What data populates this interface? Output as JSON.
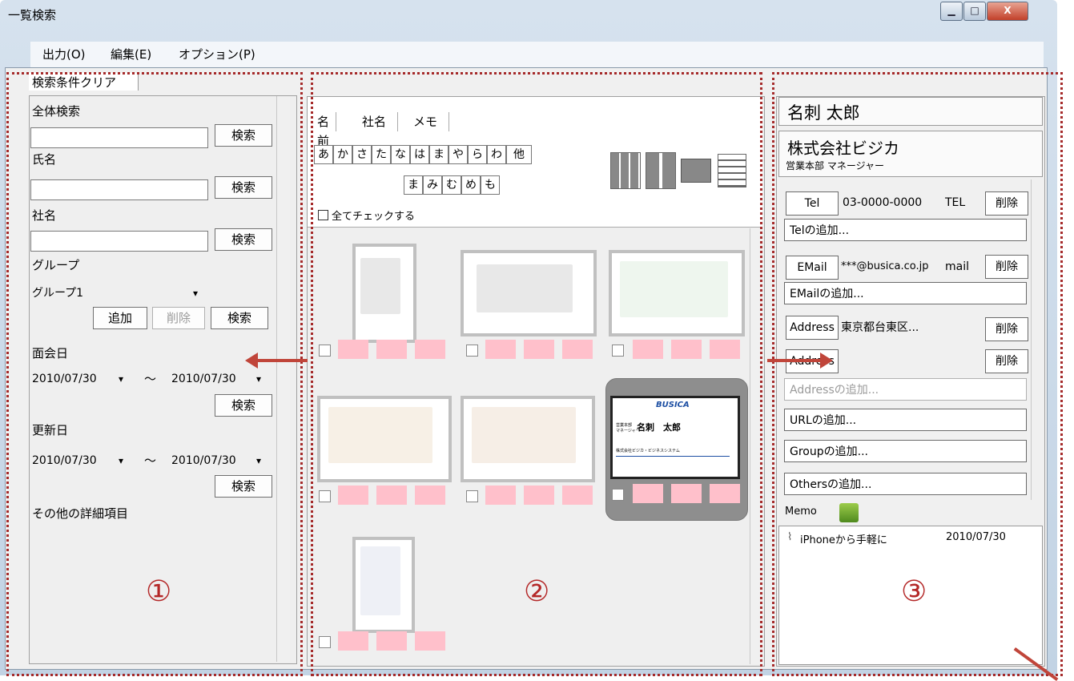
{
  "window": {
    "title": "一覧検索",
    "minimize": "▁",
    "maximize": "□",
    "close": "X"
  },
  "menu": [
    "出力(O)",
    "編集(E)",
    "オプション(P)"
  ],
  "left": {
    "clear_tab": "検索条件クリア",
    "full_search": "全体検索",
    "name": "氏名",
    "company": "社名",
    "group": "グループ",
    "group_value": "グループ1",
    "search": "検索",
    "add": "追加",
    "delete": "削除",
    "meet_date": "面会日",
    "update_date": "更新日",
    "date_from": "2010/07/30",
    "date_to": "2010/07/30",
    "tilde": "～",
    "other": "その他の詳細項目",
    "num": "①"
  },
  "middle": {
    "tabs": [
      "名前",
      "社名",
      "メモ"
    ],
    "kana_row1": [
      "あ",
      "か",
      "さ",
      "た",
      "な",
      "は",
      "ま",
      "や",
      "ら",
      "わ",
      "他"
    ],
    "kana_row2": [
      "ま",
      "み",
      "む",
      "め",
      "も"
    ],
    "check_all": "全てチェックする",
    "num": "②",
    "featured_card": {
      "logo": "BUSICA",
      "role": "営業本部\nマネージャー",
      "name": "名刺　太郎",
      "company": "株式会社ビジカ・ビジネスシステム"
    }
  },
  "right": {
    "name": "名刺 太郎",
    "company": "株式会社ビジカ",
    "dept": "営業本部 マネージャー",
    "tel_label": "Tel",
    "tel_value": "03-0000-0000",
    "tel_type": "TEL",
    "delete": "削除",
    "add_tel": "Telの追加...",
    "email_label": "EMail",
    "email_value": "***@busica.co.jp",
    "email_type": "mail",
    "add_email": "EMailの追加...",
    "address_label": "Address",
    "address_value": "東京都台東区...",
    "add_address": "Addressの追加...",
    "add_url": "URLの追加...",
    "add_group": "Groupの追加...",
    "add_others": "Othersの追加...",
    "memo": "Memo",
    "memo_text": "iPhoneから手軽に",
    "memo_date": "2010/07/30",
    "num": "③"
  }
}
